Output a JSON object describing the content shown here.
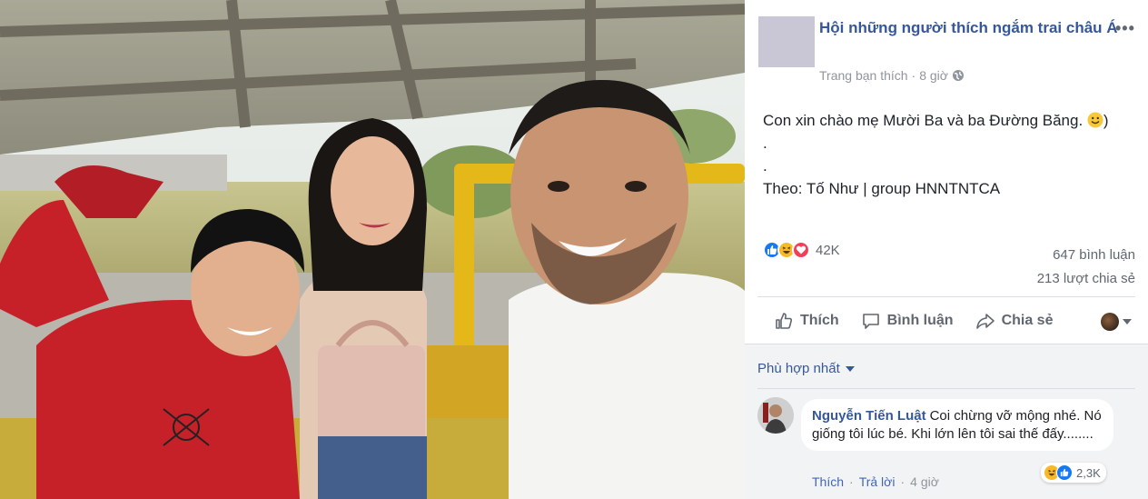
{
  "post": {
    "page_name": "Hội những người thích ngắm trai châu Á",
    "more_label": "•••",
    "meta_source": "Trang bạn thích",
    "meta_sep": "·",
    "meta_time": "8 giờ",
    "text_line1": "Con xin chào mẹ Mười Ba và ba Đường Băng.",
    "text_line1_tail": ")",
    "text_line2": ".",
    "text_line3": ".",
    "text_line4": "Theo: Tố Như | group HNNTNTCA"
  },
  "stats": {
    "reaction_count": "42K",
    "comments": "647 bình luận",
    "shares": "213 lượt chia sẻ"
  },
  "actions": {
    "like": "Thích",
    "comment": "Bình luận",
    "share": "Chia sẻ"
  },
  "comments": {
    "sort_label": "Phù hợp nhất",
    "items": [
      {
        "author": "Nguyễn Tiến Luật",
        "text": "Coi chừng vỡ mộng nhé. Nó giống tôi lúc bé. Khi lớn lên tôi sai thế đấy........",
        "reaction_count": "2,3K",
        "like": "Thích",
        "reply": "Trả lời",
        "sep": "·",
        "time": "4 giờ"
      }
    ]
  },
  "colors": {
    "link_blue": "#365899",
    "like_blue": "#1877f2",
    "haha_yellow": "#f7b928",
    "love_red": "#f33e58"
  }
}
